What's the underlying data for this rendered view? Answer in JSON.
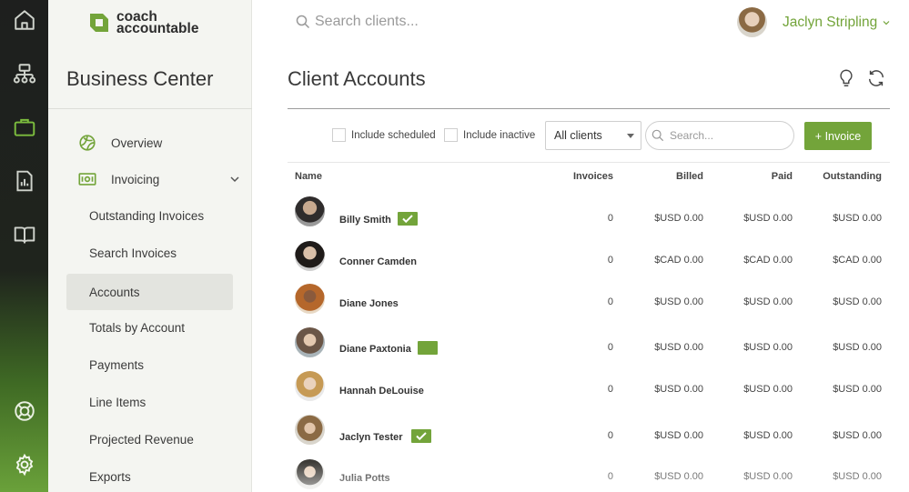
{
  "brand": {
    "line1": "coach",
    "line2": "accountable",
    "accent": "#73a43a"
  },
  "rail": {
    "items": [
      {
        "name": "home-icon"
      },
      {
        "name": "org-chart-icon"
      },
      {
        "name": "briefcase-icon",
        "active": true
      },
      {
        "name": "report-icon"
      },
      {
        "name": "book-icon"
      },
      {
        "name": "help-lifebuoy-icon"
      },
      {
        "name": "settings-gear-icon"
      }
    ]
  },
  "sidebar": {
    "title": "Business Center",
    "items": [
      {
        "label": "Overview",
        "icon": "overview-icon"
      },
      {
        "label": "Invoicing",
        "icon": "invoice-icon",
        "expandable": true
      },
      {
        "label": "Outstanding Invoices"
      },
      {
        "label": "Search Invoices"
      },
      {
        "label": "Accounts",
        "active": true
      },
      {
        "label": "Totals by Account"
      },
      {
        "label": "Payments"
      },
      {
        "label": "Line Items"
      },
      {
        "label": "Projected Revenue"
      },
      {
        "label": "Exports"
      }
    ]
  },
  "topbar": {
    "search_placeholder": "Search clients...",
    "user_name": "Jaclyn Stripling"
  },
  "main": {
    "title": "Client Accounts",
    "filters": {
      "include_scheduled": "Include scheduled",
      "include_inactive": "Include inactive",
      "select_value": "All clients",
      "search_placeholder": "Search...",
      "invoice_button": "+ Invoice"
    },
    "columns": [
      "Name",
      "Invoices",
      "Billed",
      "Paid",
      "Outstanding"
    ],
    "rows": [
      {
        "name": "Billy Smith",
        "badge": "check",
        "invoices": "0",
        "billed": "$USD 0.00",
        "paid": "$USD 0.00",
        "outstanding": "$USD 0.00"
      },
      {
        "name": "Conner Camden",
        "badge": "",
        "invoices": "0",
        "billed": "$CAD 0.00",
        "paid": "$CAD 0.00",
        "outstanding": "$CAD 0.00"
      },
      {
        "name": "Diane Jones",
        "badge": "",
        "invoices": "0",
        "billed": "$USD 0.00",
        "paid": "$USD 0.00",
        "outstanding": "$USD 0.00"
      },
      {
        "name": "Diane Paxtonia",
        "badge": "plain",
        "invoices": "0",
        "billed": "$USD 0.00",
        "paid": "$USD 0.00",
        "outstanding": "$USD 0.00"
      },
      {
        "name": "Hannah DeLouise",
        "badge": "",
        "invoices": "0",
        "billed": "$USD 0.00",
        "paid": "$USD 0.00",
        "outstanding": "$USD 0.00"
      },
      {
        "name": "Jaclyn Tester",
        "badge": "check",
        "invoices": "0",
        "billed": "$USD 0.00",
        "paid": "$USD 0.00",
        "outstanding": "$USD 0.00"
      },
      {
        "name": "Julia Potts",
        "badge": "",
        "invoices": "0",
        "billed": "$USD 0.00",
        "paid": "$USD 0.00",
        "outstanding": "$USD 0.00"
      }
    ]
  }
}
